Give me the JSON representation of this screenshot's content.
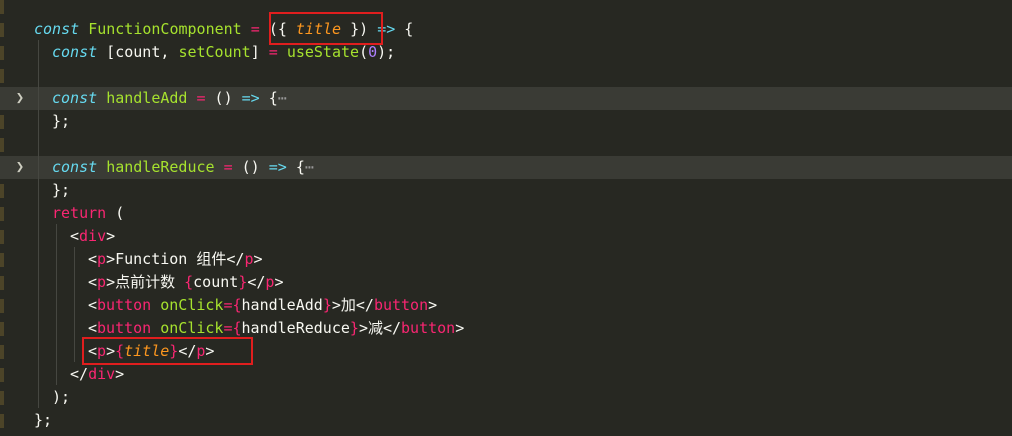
{
  "editor": {
    "lines": [
      {
        "folded": false,
        "tokens": [
          [
            "kw-i",
            "const"
          ],
          [
            "plain",
            " "
          ],
          [
            "fn",
            "FunctionComponent"
          ],
          [
            "plain",
            " "
          ],
          [
            "op",
            "="
          ],
          [
            "plain",
            " "
          ],
          [
            "plain",
            "({ "
          ],
          [
            "param",
            "title"
          ],
          [
            "plain",
            " })"
          ],
          [
            "plain",
            " "
          ],
          [
            "arrow",
            "=>"
          ],
          [
            "plain",
            " {"
          ]
        ]
      },
      {
        "folded": false,
        "tokens": [
          [
            "kw-i",
            "const"
          ],
          [
            "plain",
            " [count, "
          ],
          [
            "fn",
            "setCount"
          ],
          [
            "plain",
            "] "
          ],
          [
            "op",
            "="
          ],
          [
            "plain",
            " "
          ],
          [
            "fn",
            "useState"
          ],
          [
            "plain",
            "("
          ],
          [
            "num",
            "0"
          ],
          [
            "plain",
            ");"
          ]
        ]
      },
      {
        "folded": false,
        "tokens": []
      },
      {
        "folded": true,
        "tokens": [
          [
            "kw-i",
            "const"
          ],
          [
            "plain",
            " "
          ],
          [
            "fn",
            "handleAdd"
          ],
          [
            "plain",
            " "
          ],
          [
            "op",
            "="
          ],
          [
            "plain",
            " () "
          ],
          [
            "arrow",
            "=>"
          ],
          [
            "plain",
            " {"
          ],
          [
            "dim",
            "⋯"
          ]
        ]
      },
      {
        "folded": false,
        "tokens": [
          [
            "plain",
            "};"
          ]
        ]
      },
      {
        "folded": false,
        "tokens": []
      },
      {
        "folded": true,
        "tokens": [
          [
            "kw-i",
            "const"
          ],
          [
            "plain",
            " "
          ],
          [
            "fn",
            "handleReduce"
          ],
          [
            "plain",
            " "
          ],
          [
            "op",
            "="
          ],
          [
            "plain",
            " () "
          ],
          [
            "arrow",
            "=>"
          ],
          [
            "plain",
            " {"
          ],
          [
            "dim",
            "⋯"
          ]
        ]
      },
      {
        "folded": false,
        "tokens": [
          [
            "plain",
            "};"
          ]
        ]
      },
      {
        "folded": false,
        "tokens": [
          [
            "kw",
            "return"
          ],
          [
            "plain",
            " ("
          ]
        ]
      },
      {
        "folded": false,
        "tokens": [
          [
            "plain",
            "<"
          ],
          [
            "tag",
            "div"
          ],
          [
            "plain",
            ">"
          ]
        ]
      },
      {
        "folded": false,
        "tokens": [
          [
            "plain",
            "<"
          ],
          [
            "tag",
            "p"
          ],
          [
            "plain",
            ">Function 组件</"
          ],
          [
            "tag",
            "p"
          ],
          [
            "plain",
            ">"
          ]
        ]
      },
      {
        "folded": false,
        "tokens": [
          [
            "plain",
            "<"
          ],
          [
            "tag",
            "p"
          ],
          [
            "plain",
            ">点前计数 "
          ],
          [
            "op",
            "{"
          ],
          [
            "plain",
            "count"
          ],
          [
            "op",
            "}"
          ],
          [
            "plain",
            "</"
          ],
          [
            "tag",
            "p"
          ],
          [
            "plain",
            ">"
          ]
        ]
      },
      {
        "folded": false,
        "tokens": [
          [
            "plain",
            "<"
          ],
          [
            "tag",
            "button"
          ],
          [
            "plain",
            " "
          ],
          [
            "attr",
            "onClick"
          ],
          [
            "op",
            "={"
          ],
          [
            "plain",
            "handleAdd"
          ],
          [
            "op",
            "}"
          ],
          [
            "plain",
            ">加</"
          ],
          [
            "tag",
            "button"
          ],
          [
            "plain",
            ">"
          ]
        ]
      },
      {
        "folded": false,
        "tokens": [
          [
            "plain",
            "<"
          ],
          [
            "tag",
            "button"
          ],
          [
            "plain",
            " "
          ],
          [
            "attr",
            "onClick"
          ],
          [
            "op",
            "={"
          ],
          [
            "plain",
            "handleReduce"
          ],
          [
            "op",
            "}"
          ],
          [
            "plain",
            ">减</"
          ],
          [
            "tag",
            "button"
          ],
          [
            "plain",
            ">"
          ]
        ]
      },
      {
        "folded": false,
        "tokens": [
          [
            "plain",
            "<"
          ],
          [
            "tag",
            "p"
          ],
          [
            "plain",
            ">"
          ],
          [
            "op",
            "{"
          ],
          [
            "param",
            "title"
          ],
          [
            "op",
            "}"
          ],
          [
            "plain",
            "</"
          ],
          [
            "tag",
            "p"
          ],
          [
            "plain",
            ">"
          ]
        ]
      },
      {
        "folded": false,
        "tokens": [
          [
            "plain",
            "</"
          ],
          [
            "tag",
            "div"
          ],
          [
            "plain",
            ">"
          ]
        ]
      },
      {
        "folded": false,
        "tokens": [
          [
            "plain",
            ");"
          ]
        ]
      },
      {
        "folded": false,
        "tokens": [
          [
            "plain",
            "};"
          ]
        ]
      }
    ],
    "fold_icon": "chevron-right-icon",
    "colors": {
      "background": "#272822",
      "keyword": "#66d9ef",
      "operator": "#f92672",
      "function": "#a6e22e",
      "parameter": "#fd971f",
      "number": "#ae81ff",
      "highlight_box": "#e01e1e"
    }
  }
}
